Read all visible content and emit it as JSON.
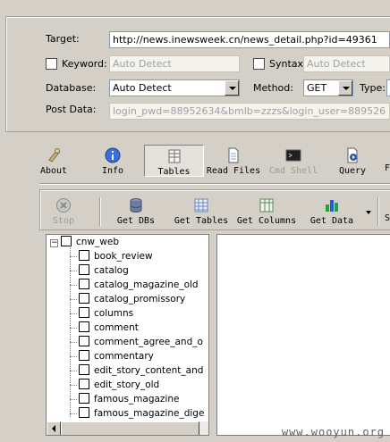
{
  "form": {
    "target_label": "Target:",
    "target_value": "http://news.inewsweek.cn/news_detail.php?id=49361",
    "keyword_label": "Keyword:",
    "keyword_placeholder": "Auto Detect",
    "syntax_label": "Syntax:",
    "syntax_placeholder": "Auto Detect",
    "database_label": "Database:",
    "database_value": "Auto Detect",
    "method_label": "Method:",
    "method_value": "GET",
    "type_label": "Type:",
    "postdata_label": "Post Data:",
    "postdata_value": "login_pwd=88952634&bmlb=zzzs&login_user=889526"
  },
  "main_toolbar": [
    {
      "label": "About",
      "icon": "about-icon"
    },
    {
      "label": "Info",
      "icon": "info-icon"
    },
    {
      "label": "Tables",
      "icon": "tables-icon"
    },
    {
      "label": "Read Files",
      "icon": "read-files-icon"
    },
    {
      "label": "Cmd Shell",
      "icon": "cmd-shell-icon"
    },
    {
      "label": "Query",
      "icon": "query-icon"
    }
  ],
  "sub_toolbar": [
    {
      "label": "Stop",
      "icon": "stop-icon"
    },
    {
      "label": "Get DBs",
      "icon": "database-icon"
    },
    {
      "label": "Get Tables",
      "icon": "table-grid-icon"
    },
    {
      "label": "Get Columns",
      "icon": "columns-icon"
    },
    {
      "label": "Get Data",
      "icon": "data-chart-icon"
    }
  ],
  "tree": {
    "root": "cnw_web",
    "items": [
      "book_review",
      "catalog",
      "catalog_magazine_old",
      "catalog_promissory",
      "columns",
      "comment",
      "comment_agree_and_o",
      "commentary",
      "edit_story_content_and",
      "edit_story_old",
      "famous_magazine",
      "famous_magazine_dige"
    ]
  },
  "watermark": "www.wooyun.org"
}
